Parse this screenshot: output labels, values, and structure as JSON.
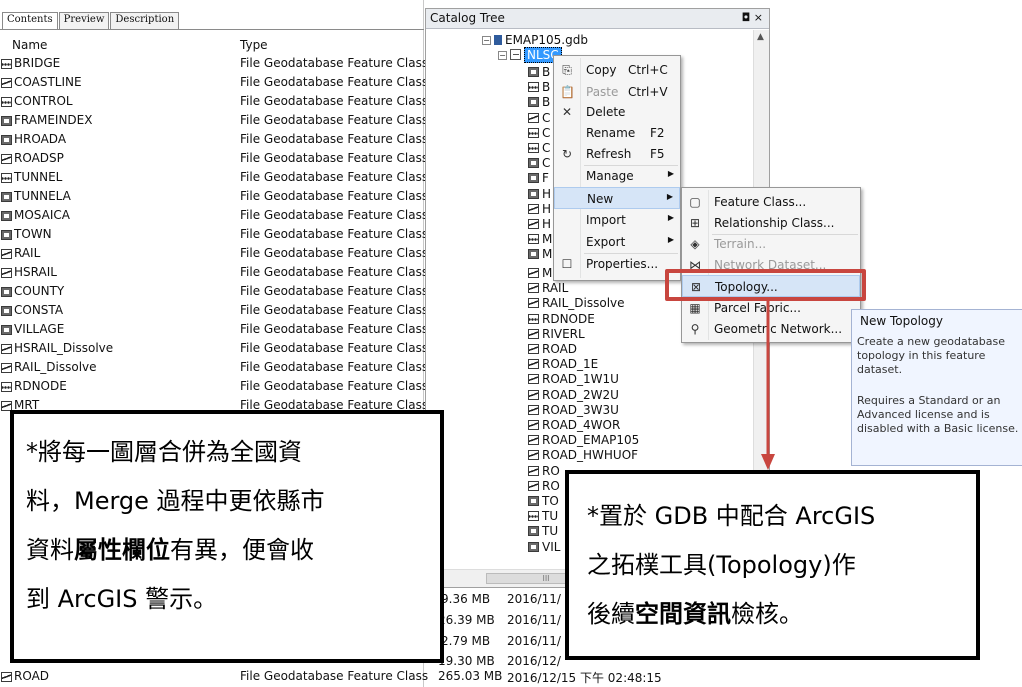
{
  "contents": {
    "tabs": [
      "Contents",
      "Preview",
      "Description"
    ],
    "columns": [
      "Name",
      "Type"
    ],
    "rows": [
      {
        "name": "BRIDGE",
        "type": "File Geodatabase Feature Class",
        "icon": "point-feature-icon"
      },
      {
        "name": "COASTLINE",
        "type": "File Geodatabase Feature Class",
        "icon": "line-feature-icon"
      },
      {
        "name": "CONTROL",
        "type": "File Geodatabase Feature Class",
        "icon": "point-feature-icon"
      },
      {
        "name": "FRAMEINDEX",
        "type": "File Geodatabase Feature Class",
        "icon": "polygon-feature-icon"
      },
      {
        "name": "HROADA",
        "type": "File Geodatabase Feature Class",
        "icon": "polygon-feature-icon"
      },
      {
        "name": "ROADSP",
        "type": "File Geodatabase Feature Class",
        "icon": "line-feature-icon"
      },
      {
        "name": "TUNNEL",
        "type": "File Geodatabase Feature Class",
        "icon": "point-feature-icon"
      },
      {
        "name": "TUNNELA",
        "type": "File Geodatabase Feature Class",
        "icon": "polygon-feature-icon"
      },
      {
        "name": "MOSAICA",
        "type": "File Geodatabase Feature Class",
        "icon": "polygon-feature-icon"
      },
      {
        "name": "TOWN",
        "type": "File Geodatabase Feature Class",
        "icon": "polygon-feature-icon"
      },
      {
        "name": "RAIL",
        "type": "File Geodatabase Feature Class",
        "icon": "line-feature-icon"
      },
      {
        "name": "HSRAIL",
        "type": "File Geodatabase Feature Class",
        "icon": "line-feature-icon"
      },
      {
        "name": "COUNTY",
        "type": "File Geodatabase Feature Class",
        "icon": "polygon-feature-icon"
      },
      {
        "name": "CONSTA",
        "type": "File Geodatabase Feature Class",
        "icon": "polygon-feature-icon"
      },
      {
        "name": "VILLAGE",
        "type": "File Geodatabase Feature Class",
        "icon": "polygon-feature-icon"
      },
      {
        "name": "HSRAIL_Dissolve",
        "type": "File Geodatabase Feature Class",
        "icon": "line-feature-icon"
      },
      {
        "name": "RAIL_Dissolve",
        "type": "File Geodatabase Feature Class",
        "icon": "line-feature-icon"
      },
      {
        "name": "RDNODE",
        "type": "File Geodatabase Feature Class",
        "icon": "point-feature-icon"
      },
      {
        "name": "MRT",
        "type": "File Geodatabase Feature Class",
        "icon": "line-feature-icon"
      }
    ],
    "bottom_row": {
      "name": "ROAD",
      "type": "File Geodatabase Feature Class",
      "size": "265.03 MB",
      "modified": "2016/12/15 下午 02:48:15"
    },
    "sizes": [
      {
        "size": "9.36 MB",
        "modified": "2016/11/"
      },
      {
        "size": "26.39 MB",
        "modified": "2016/11/"
      },
      {
        "size": "2.79 MB",
        "modified": "2016/11/"
      },
      {
        "size": "19.30 MB",
        "modified": "2016/12/"
      }
    ]
  },
  "catalog": {
    "title": "Catalog Tree",
    "title_buttons": "◘ ×",
    "gdb": "EMAP105.gdb",
    "dataset": "NLSC",
    "hidden_children": [
      "B",
      "B",
      "B",
      "C",
      "C",
      "C",
      "C",
      "F",
      "H",
      "H",
      "H",
      "M",
      "M"
    ],
    "children": [
      "MRT",
      "RAIL",
      "RAIL_Dissolve",
      "RDNODE",
      "RIVERL",
      "ROAD",
      "ROAD_1E",
      "ROAD_1W1U",
      "ROAD_2W2U",
      "ROAD_3W3U",
      "ROAD_4WOR",
      "ROAD_EMAP105",
      "ROAD_HWHUOF",
      "RO",
      "RO",
      "TO",
      "TU",
      "TU",
      "VIL"
    ],
    "hscroll_grip": "III"
  },
  "context_menu": {
    "items": [
      {
        "label": "Copy",
        "shortcut": "Ctrl+C",
        "icon": "copy-icon",
        "disabled": false
      },
      {
        "label": "Paste",
        "shortcut": "Ctrl+V",
        "icon": "paste-icon",
        "disabled": true
      },
      {
        "label": "Delete",
        "shortcut": "",
        "icon": "delete-icon",
        "disabled": false
      },
      {
        "label": "Rename",
        "shortcut": "F2",
        "icon": "",
        "disabled": false
      },
      {
        "label": "Refresh",
        "shortcut": "F5",
        "icon": "refresh-icon",
        "disabled": false
      },
      {
        "label": "Manage",
        "shortcut": "",
        "icon": "",
        "submenu": true
      },
      {
        "label": "New",
        "shortcut": "",
        "icon": "",
        "submenu": true,
        "highlighted": true
      },
      {
        "label": "Import",
        "shortcut": "",
        "icon": "",
        "submenu": true
      },
      {
        "label": "Export",
        "shortcut": "",
        "icon": "",
        "submenu": true
      },
      {
        "label": "Properties...",
        "shortcut": "",
        "icon": "properties-icon",
        "disabled": false
      }
    ]
  },
  "new_submenu": {
    "items": [
      {
        "label": "Feature Class...",
        "icon": "feature-class-icon",
        "disabled": false
      },
      {
        "label": "Relationship Class...",
        "icon": "relationship-class-icon",
        "disabled": false
      },
      {
        "label": "Terrain...",
        "icon": "terrain-icon",
        "disabled": true
      },
      {
        "label": "Network Dataset...",
        "icon": "network-dataset-icon",
        "disabled": true
      },
      {
        "label": "Topology...",
        "icon": "topology-icon",
        "disabled": false,
        "highlighted": true
      },
      {
        "label": "Parcel Fabric...",
        "icon": "parcel-fabric-icon",
        "disabled": false
      },
      {
        "label": "Geometric Network...",
        "icon": "geometric-network-icon",
        "disabled": false
      }
    ]
  },
  "tooltip": {
    "title": "New Topology",
    "p1": "Create a new geodatabase topology in this feature dataset.",
    "p2": "Requires a Standard or an Advanced license and is disabled with a Basic license."
  },
  "callout_left": {
    "line1": "*將每一圖層合併為全國資",
    "line2": "料，Merge 過程中更依縣市",
    "line3_pre": "資料",
    "line3_bold": "屬性欄位",
    "line3_post": "有異，便會收",
    "line4": "到 ArcGIS 警示。"
  },
  "callout_right": {
    "line1": "*置於 GDB 中配合 ArcGIS",
    "line2": "之拓樸工具(Topology)作",
    "line3_pre": "後續",
    "line3_bold": "空間資訊",
    "line3_post": "檢核。"
  },
  "colors": {
    "highlight_box": "#c8463f",
    "selection": "#3399ff",
    "menu_hover": "#d6e5f7"
  }
}
